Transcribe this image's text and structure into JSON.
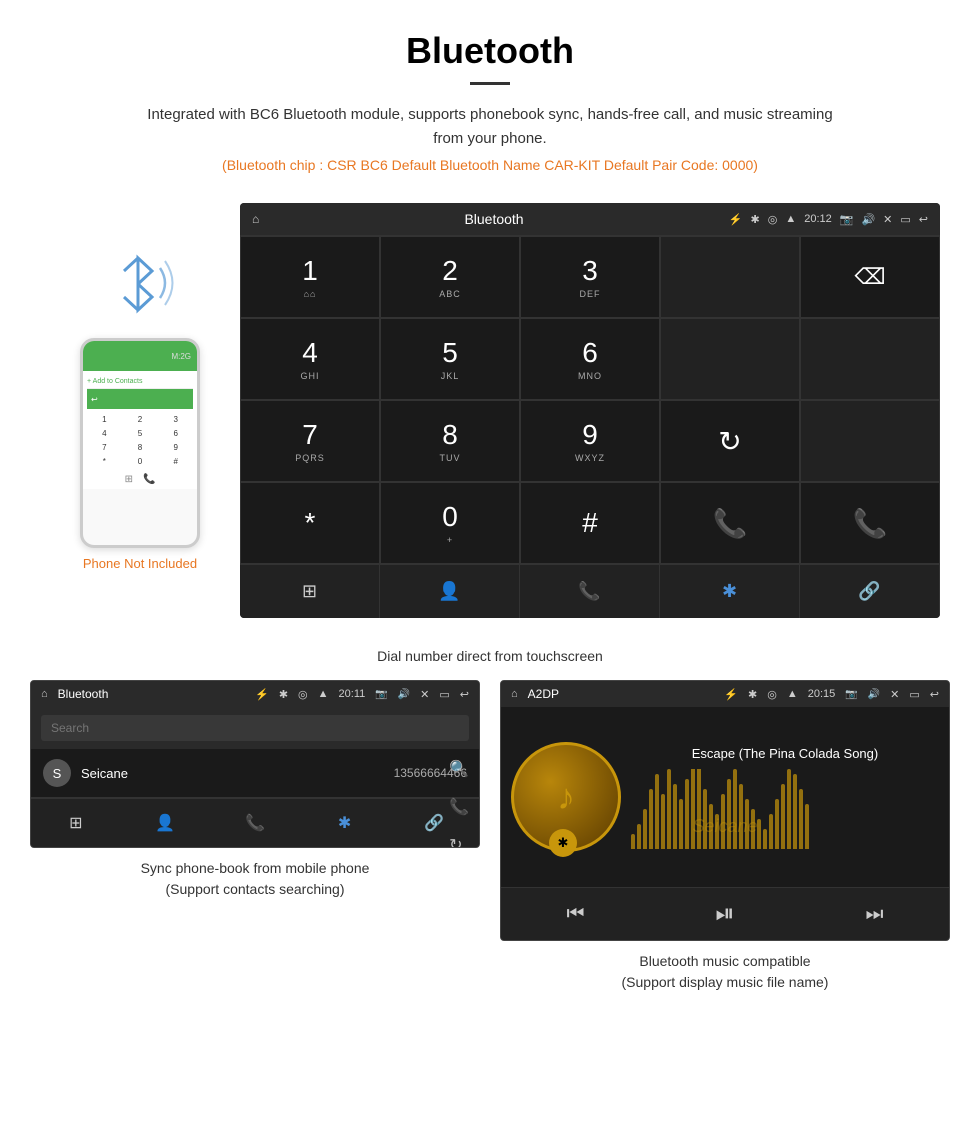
{
  "page": {
    "title": "Bluetooth",
    "desc": "Integrated with BC6 Bluetooth module, supports phonebook sync, hands-free call, and music streaming from your phone.",
    "specs": "(Bluetooth chip : CSR BC6    Default Bluetooth Name CAR-KIT    Default Pair Code: 0000)"
  },
  "dial_screen": {
    "topbar": {
      "home": "⌂",
      "title": "Bluetooth",
      "usb": "⚡",
      "time": "20:12"
    },
    "keys": [
      {
        "num": "1",
        "sub": ""
      },
      {
        "num": "2",
        "sub": "ABC"
      },
      {
        "num": "3",
        "sub": "DEF"
      },
      {
        "num": "",
        "sub": ""
      },
      {
        "num": "⌫",
        "sub": ""
      }
    ],
    "keys2": [
      {
        "num": "4",
        "sub": "GHI"
      },
      {
        "num": "5",
        "sub": "JKL"
      },
      {
        "num": "6",
        "sub": "MNO"
      },
      {
        "num": "",
        "sub": ""
      },
      {
        "num": "",
        "sub": ""
      }
    ],
    "keys3": [
      {
        "num": "7",
        "sub": "PQRS"
      },
      {
        "num": "8",
        "sub": "TUV"
      },
      {
        "num": "9",
        "sub": "WXYZ"
      },
      {
        "num": "↻",
        "sub": ""
      },
      {
        "num": "",
        "sub": ""
      }
    ],
    "keys4": [
      {
        "num": "*",
        "sub": ""
      },
      {
        "num": "0",
        "sub": "+"
      },
      {
        "num": "#",
        "sub": ""
      },
      {
        "num": "📞",
        "sub": "green"
      },
      {
        "num": "📞",
        "sub": "red"
      }
    ],
    "caption": "Dial number direct from touchscreen"
  },
  "phone_aside": {
    "not_included": "Phone Not Included"
  },
  "phonebook_screen": {
    "topbar_title": "Bluetooth",
    "search_placeholder": "Search",
    "contacts": [
      {
        "initial": "S",
        "name": "Seicane",
        "phone": "13566664466"
      }
    ],
    "caption1": "Sync phone-book from mobile phone",
    "caption2": "(Support contacts searching)"
  },
  "music_screen": {
    "topbar_title": "A2DP",
    "song_title": "Escape (The Pina Colada Song)",
    "watermark": "Seicane",
    "caption1": "Bluetooth music compatible",
    "caption2": "(Support display music file name)"
  },
  "bar_heights": [
    15,
    25,
    40,
    60,
    75,
    55,
    80,
    65,
    50,
    70,
    90,
    85,
    60,
    45,
    35,
    55,
    70,
    80,
    65,
    50,
    40,
    30,
    20,
    35,
    50,
    65,
    80,
    75,
    60,
    45
  ]
}
